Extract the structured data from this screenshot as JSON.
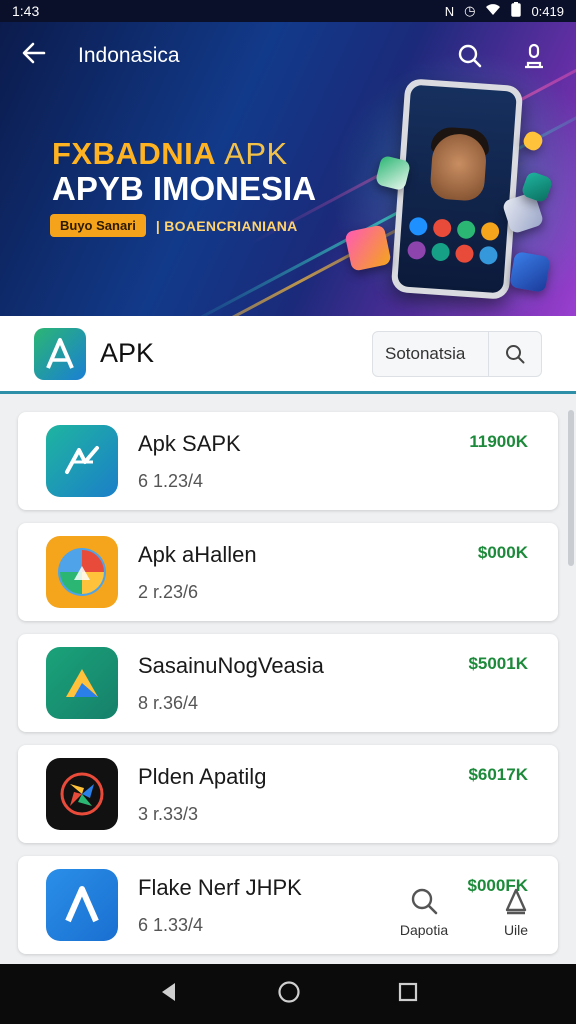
{
  "status_bar": {
    "time_left": "1:43",
    "time_right": "0:419",
    "icons": [
      "notification-n-icon",
      "alarm-icon",
      "wifi-icon",
      "battery-icon"
    ]
  },
  "top_bar": {
    "title": "Indonasica",
    "icons": [
      "back-arrow-icon",
      "search-icon",
      "profile-icon"
    ]
  },
  "banner": {
    "headline_bold": "FXBADNIA",
    "headline_light": "APK",
    "headline_2": "APYB IMONESIA",
    "pill_text": "Buyo Sanari",
    "tagline": "| BOAENCRIANIANA"
  },
  "app_header": {
    "name": "APK",
    "search_value": "Sotonatsia"
  },
  "apps": [
    {
      "name": "Apk SAPK",
      "version": "6 1.23/4",
      "size": "11900K",
      "icon_colors": [
        "#1fb5a0",
        "#1b7fc9"
      ],
      "icon": "ak-glyph-icon"
    },
    {
      "name": "Apk aHallen",
      "version": "2 r.23/6",
      "size": "$000K",
      "icon_colors": [
        "#f4a51c",
        "#e84b3a"
      ],
      "icon": "triangle-drive-icon"
    },
    {
      "name": "SasainuNogVeasia",
      "version": "8 r.36/4",
      "size": "$5001K",
      "icon_colors": [
        "#1aa37a",
        "#16806a"
      ],
      "icon": "arrow-triangle-icon"
    },
    {
      "name": "Plden Apatilg",
      "version": "3 r.33/3",
      "size": "$6017K",
      "icon_colors": [
        "#111111",
        "#222222"
      ],
      "icon": "pinwheel-icon"
    },
    {
      "name": "Flake Nerf JHPK",
      "version": "6 1.33/4",
      "size": "$000FK",
      "icon_colors": [
        "#2a8fe8",
        "#1a6fd0"
      ],
      "icon": "a-letter-icon"
    }
  ],
  "bottom_tabs": [
    {
      "label": "Dapotia",
      "icon": "search-icon"
    },
    {
      "label": "Uile",
      "icon": "profile-icon"
    }
  ],
  "nav_bar": {
    "icons": [
      "back-triangle-icon",
      "home-circle-icon",
      "recents-square-icon"
    ]
  }
}
